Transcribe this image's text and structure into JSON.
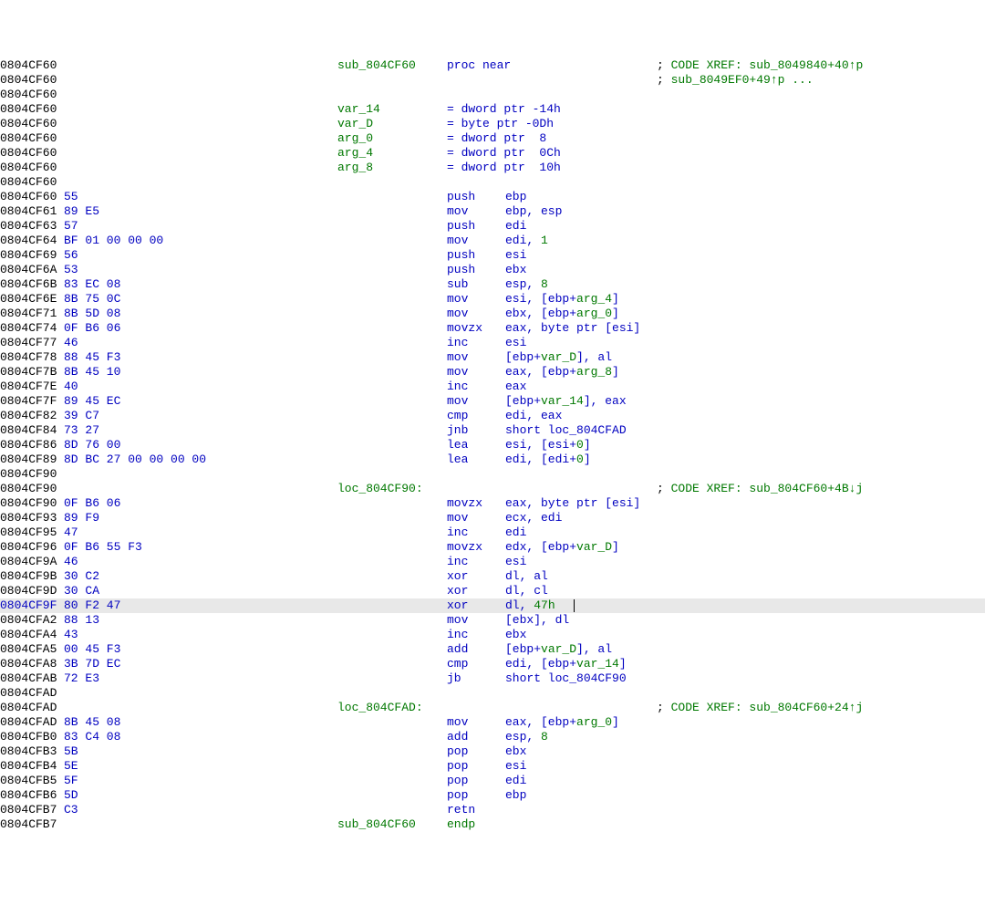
{
  "proc_name": "sub_804CF60",
  "proc": "proc near",
  "endp": "endp",
  "xref1": "; CODE XREF: sub_8049840+40↑p",
  "xref2": "; sub_8049EF0+49↑p ...",
  "xref_loop": "; CODE XREF: sub_804CF60+4B↓j",
  "xref_end": "; CODE XREF: sub_804CF60+24↑j",
  "vars": {
    "var_14": {
      "name": "var_14",
      "def": "= dword ptr -14h"
    },
    "var_D": {
      "name": "var_D",
      "def": "= byte ptr -0Dh"
    },
    "arg_0": {
      "name": "arg_0",
      "def": "= dword ptr  8"
    },
    "arg_4": {
      "name": "arg_4",
      "def": "= dword ptr  0Ch"
    },
    "arg_8": {
      "name": "arg_8",
      "def": "= dword ptr  10h"
    }
  },
  "loc_804CF90": "loc_804CF90:",
  "loc_804CFAD": "loc_804CFAD:",
  "lines": [
    {
      "addr": "0804CF60",
      "bytes": "",
      "label": "sub_804CF60",
      "mnemonic": "proc near",
      "ops": "",
      "xref": "; CODE XREF: sub_8049840+40↑p"
    },
    {
      "addr": "0804CF60",
      "bytes": "",
      "label": "",
      "mnemonic": "",
      "ops": "",
      "xref": "; sub_8049EF0+49↑p ..."
    },
    {
      "addr": "0804CF60",
      "bytes": ""
    },
    {
      "addr": "0804CF60",
      "bytes": "",
      "label": "var_14",
      "def": "= dword ptr -14h"
    },
    {
      "addr": "0804CF60",
      "bytes": "",
      "label": "var_D",
      "def": "= byte ptr -0Dh"
    },
    {
      "addr": "0804CF60",
      "bytes": "",
      "label": "arg_0",
      "def": "= dword ptr  8"
    },
    {
      "addr": "0804CF60",
      "bytes": "",
      "label": "arg_4",
      "def": "= dword ptr  0Ch"
    },
    {
      "addr": "0804CF60",
      "bytes": "",
      "label": "arg_8",
      "def": "= dword ptr  10h"
    },
    {
      "addr": "0804CF60",
      "bytes": ""
    },
    {
      "addr": "0804CF60",
      "bytes": "55",
      "mnemonic": "push",
      "ops_html": "ebp"
    },
    {
      "addr": "0804CF61",
      "bytes": "89 E5",
      "mnemonic": "mov",
      "ops_html": "ebp, esp"
    },
    {
      "addr": "0804CF63",
      "bytes": "57",
      "mnemonic": "push",
      "ops_html": "edi"
    },
    {
      "addr": "0804CF64",
      "bytes": "BF 01 00 00 00",
      "mnemonic": "mov",
      "ops_html": "edi, <span class='green'>1</span>"
    },
    {
      "addr": "0804CF69",
      "bytes": "56",
      "mnemonic": "push",
      "ops_html": "esi"
    },
    {
      "addr": "0804CF6A",
      "bytes": "53",
      "mnemonic": "push",
      "ops_html": "ebx"
    },
    {
      "addr": "0804CF6B",
      "bytes": "83 EC 08",
      "mnemonic": "sub",
      "ops_html": "esp, <span class='green'>8</span>"
    },
    {
      "addr": "0804CF6E",
      "bytes": "8B 75 0C",
      "mnemonic": "mov",
      "ops_html": "esi, [ebp+<span class='green'>arg_4</span>]"
    },
    {
      "addr": "0804CF71",
      "bytes": "8B 5D 08",
      "mnemonic": "mov",
      "ops_html": "ebx, [ebp+<span class='green'>arg_0</span>]"
    },
    {
      "addr": "0804CF74",
      "bytes": "0F B6 06",
      "mnemonic": "movzx",
      "ops_html": "eax, byte ptr [esi]"
    },
    {
      "addr": "0804CF77",
      "bytes": "46",
      "mnemonic": "inc",
      "ops_html": "esi"
    },
    {
      "addr": "0804CF78",
      "bytes": "88 45 F3",
      "mnemonic": "mov",
      "ops_html": "[ebp+<span class='green'>var_D</span>], al"
    },
    {
      "addr": "0804CF7B",
      "bytes": "8B 45 10",
      "mnemonic": "mov",
      "ops_html": "eax, [ebp+<span class='green'>arg_8</span>]"
    },
    {
      "addr": "0804CF7E",
      "bytes": "40",
      "mnemonic": "inc",
      "ops_html": "eax"
    },
    {
      "addr": "0804CF7F",
      "bytes": "89 45 EC",
      "mnemonic": "mov",
      "ops_html": "[ebp+<span class='green'>var_14</span>], eax"
    },
    {
      "addr": "0804CF82",
      "bytes": "39 C7",
      "mnemonic": "cmp",
      "ops_html": "edi, eax"
    },
    {
      "addr": "0804CF84",
      "bytes": "73 27",
      "mnemonic": "jnb",
      "ops_html": "short loc_804CFAD"
    },
    {
      "addr": "0804CF86",
      "bytes": "8D 76 00",
      "mnemonic": "lea",
      "ops_html": "esi, [esi+<span class='green'>0</span>]"
    },
    {
      "addr": "0804CF89",
      "bytes": "8D BC 27 00 00 00 00",
      "mnemonic": "lea",
      "ops_html": "edi, [edi+<span class='green'>0</span>]"
    },
    {
      "addr": "0804CF90",
      "bytes": ""
    },
    {
      "addr": "0804CF90",
      "bytes": "",
      "loc": "loc_804CF90:",
      "xref": "; CODE XREF: sub_804CF60+4B↓j"
    },
    {
      "addr": "0804CF90",
      "bytes": "0F B6 06",
      "mnemonic": "movzx",
      "ops_html": "eax, byte ptr [esi]"
    },
    {
      "addr": "0804CF93",
      "bytes": "89 F9",
      "mnemonic": "mov",
      "ops_html": "ecx, edi"
    },
    {
      "addr": "0804CF95",
      "bytes": "47",
      "mnemonic": "inc",
      "ops_html": "edi"
    },
    {
      "addr": "0804CF96",
      "bytes": "0F B6 55 F3",
      "mnemonic": "movzx",
      "ops_html": "edx, [ebp+<span class='green'>var_D</span>]"
    },
    {
      "addr": "0804CF9A",
      "bytes": "46",
      "mnemonic": "inc",
      "ops_html": "esi"
    },
    {
      "addr": "0804CF9B",
      "bytes": "30 C2",
      "mnemonic": "xor",
      "ops_html": "dl, al"
    },
    {
      "addr": "0804CF9D",
      "bytes": "30 CA",
      "mnemonic": "xor",
      "ops_html": "dl, cl"
    },
    {
      "addr": "0804CF9F",
      "bytes": "80 F2 47",
      "mnemonic": "xor",
      "ops_html": "dl, <span class='green'>47h</span>",
      "highlight": true,
      "cursor": true
    },
    {
      "addr": "0804CFA2",
      "bytes": "88 13",
      "mnemonic": "mov",
      "ops_html": "[ebx], dl"
    },
    {
      "addr": "0804CFA4",
      "bytes": "43",
      "mnemonic": "inc",
      "ops_html": "ebx"
    },
    {
      "addr": "0804CFA5",
      "bytes": "00 45 F3",
      "mnemonic": "add",
      "ops_html": "[ebp+<span class='green'>var_D</span>], al"
    },
    {
      "addr": "0804CFA8",
      "bytes": "3B 7D EC",
      "mnemonic": "cmp",
      "ops_html": "edi, [ebp+<span class='green'>var_14</span>]"
    },
    {
      "addr": "0804CFAB",
      "bytes": "72 E3",
      "mnemonic": "jb",
      "ops_html": "short loc_804CF90"
    },
    {
      "addr": "0804CFAD",
      "bytes": ""
    },
    {
      "addr": "0804CFAD",
      "bytes": "",
      "loc": "loc_804CFAD:",
      "xref": "; CODE XREF: sub_804CF60+24↑j"
    },
    {
      "addr": "0804CFAD",
      "bytes": "8B 45 08",
      "mnemonic": "mov",
      "ops_html": "eax, [ebp+<span class='green'>arg_0</span>]"
    },
    {
      "addr": "0804CFB0",
      "bytes": "83 C4 08",
      "mnemonic": "add",
      "ops_html": "esp, <span class='green'>8</span>"
    },
    {
      "addr": "0804CFB3",
      "bytes": "5B",
      "mnemonic": "pop",
      "ops_html": "ebx"
    },
    {
      "addr": "0804CFB4",
      "bytes": "5E",
      "mnemonic": "pop",
      "ops_html": "esi"
    },
    {
      "addr": "0804CFB5",
      "bytes": "5F",
      "mnemonic": "pop",
      "ops_html": "edi"
    },
    {
      "addr": "0804CFB6",
      "bytes": "5D",
      "mnemonic": "pop",
      "ops_html": "ebp"
    },
    {
      "addr": "0804CFB7",
      "bytes": "C3",
      "mnemonic": "retn",
      "ops_html": ""
    },
    {
      "addr": "0804CFB7",
      "bytes": "",
      "label": "sub_804CF60",
      "mnemonic_green": "endp"
    }
  ]
}
